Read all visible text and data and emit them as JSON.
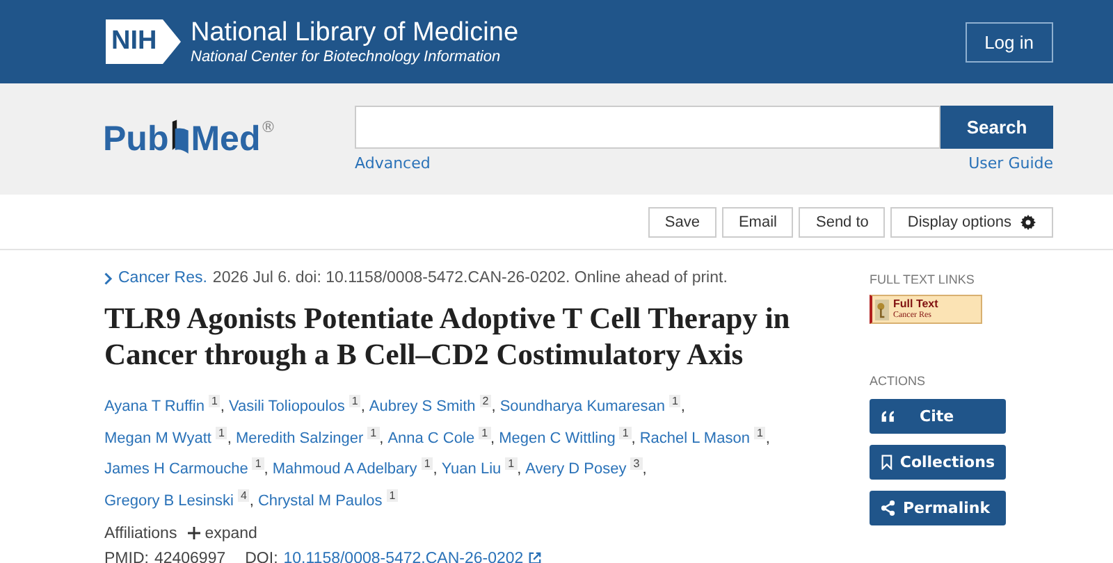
{
  "header": {
    "nih_mark": "NIH",
    "title": "National Library of Medicine",
    "subtitle": "National Center for Biotechnology Information",
    "login": "Log in"
  },
  "search": {
    "logo": [
      "Pub",
      "Med"
    ],
    "logo_mark": "®",
    "button": "Search",
    "advanced": "Advanced",
    "guide": "User Guide"
  },
  "toolbar": {
    "buttons": [
      {
        "label": "Save",
        "kind": "plain"
      },
      {
        "label": "Email",
        "kind": "plain"
      },
      {
        "label": "Send to",
        "kind": "plain"
      },
      {
        "label": "Display options",
        "kind": "settings"
      }
    ]
  },
  "article": {
    "journal": "Cancer Res.",
    "citation": "2026 Jul 6. doi: 10.1158/0008-5472.CAN-26-0202. Online ahead of print.",
    "title": "TLR9 Agonists Potentiate Adoptive T Cell Therapy in Cancer through a B Cell–CD2 Costimulatory Axis",
    "authors": [
      {
        "name": "Ayana T Ruffin",
        "aff": "1",
        "sep": ","
      },
      {
        "name": "Vasili Toliopoulos",
        "aff": "1",
        "sep": ","
      },
      {
        "name": "Aubrey S Smith",
        "aff": "2",
        "sep": ","
      },
      {
        "name": "Soundharya Kumaresan",
        "aff": "1",
        "sep": ","
      },
      {
        "name": "Megan M Wyatt",
        "aff": "1",
        "sep": ","
      },
      {
        "name": "Meredith Salzinger",
        "aff": "1",
        "sep": ","
      },
      {
        "name": "Anna C Cole",
        "aff": "1",
        "sep": ","
      },
      {
        "name": "Megen C Wittling",
        "aff": "1",
        "sep": ","
      },
      {
        "name": "Rachel L Mason",
        "aff": "1",
        "sep": ","
      },
      {
        "name": "James H Carmouche",
        "aff": "1",
        "sep": ","
      },
      {
        "name": "Mahmoud A Adelbary",
        "aff": "1",
        "sep": ","
      },
      {
        "name": "Yuan Liu",
        "aff": "1",
        "sep": ","
      },
      {
        "name": "Avery D Posey",
        "aff": "3",
        "sep": ","
      },
      {
        "name": "Gregory B Lesinski",
        "aff": "4",
        "sep": ","
      },
      {
        "name": "Chrystal M Paulos",
        "aff": "1"
      }
    ],
    "affiliations": "Affiliations",
    "expand": "expand",
    "pmid_label": "PMID:",
    "pmid": "42406997",
    "doi_label": "DOI:",
    "doi": "10.1158/0008-5472.CAN-26-0202"
  },
  "sidebar": {
    "links_heading": "FULL TEXT LINKS",
    "full_text": {
      "title": "Full Text",
      "source": "Cancer Res"
    },
    "actions_heading": "ACTIONS",
    "actions": [
      {
        "label": "Cite",
        "kind": "cite"
      },
      {
        "label": "Collections",
        "kind": "collections"
      },
      {
        "label": "Permalink",
        "kind": "permalink"
      }
    ]
  }
}
